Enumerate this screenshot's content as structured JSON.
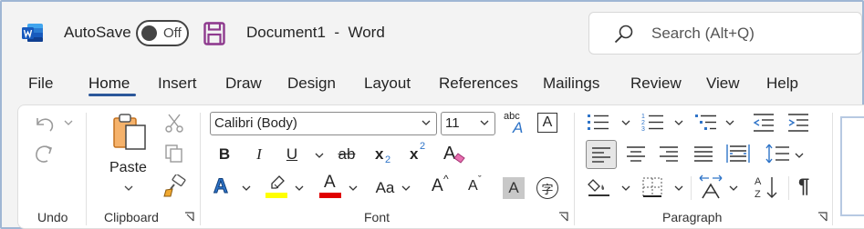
{
  "titlebar": {
    "autosave_label": "AutoSave",
    "autosave_state": "Off",
    "document_title": "Document1  -  Word",
    "search_placeholder": "Search (Alt+Q)"
  },
  "tabs": [
    {
      "label": "File",
      "active": false
    },
    {
      "label": "Home",
      "active": true
    },
    {
      "label": "Insert",
      "active": false
    },
    {
      "label": "Draw",
      "active": false
    },
    {
      "label": "Design",
      "active": false
    },
    {
      "label": "Layout",
      "active": false
    },
    {
      "label": "References",
      "active": false
    },
    {
      "label": "Mailings",
      "active": false
    },
    {
      "label": "Review",
      "active": false
    },
    {
      "label": "View",
      "active": false
    },
    {
      "label": "Help",
      "active": false
    }
  ],
  "groups": {
    "undo": "Undo",
    "clipboard": "Clipboard",
    "font": "Font",
    "paragraph": "Paragraph"
  },
  "clipboard": {
    "paste_label": "Paste"
  },
  "font": {
    "font_name": "Calibri (Body)",
    "font_size": "11",
    "bold": "B",
    "italic": "I",
    "underline": "U",
    "strike": "ab",
    "subscript_base": "x",
    "subscript_mark": "2",
    "superscript_base": "x",
    "superscript_mark": "2",
    "change_case": "Aa",
    "grow": "A",
    "shrink": "A",
    "shading_char": "A",
    "phonetic_top": "abc",
    "phonetic_base": "A",
    "text_effects": "A",
    "font_color": "A",
    "enclose_char": "字",
    "char_border": "A"
  },
  "colors": {
    "word_blue": "#2b579a",
    "highlight_yellow": "#ffff00",
    "font_red": "#e00000",
    "save_purple": "#8e3a8e",
    "text_effects_blue": "#2f74c8"
  },
  "icons": [
    "word-logo-icon",
    "save-icon",
    "search-icon",
    "undo-icon",
    "redo-icon",
    "cut-icon",
    "copy-icon",
    "format-painter-icon",
    "eraser-icon",
    "bullets-icon",
    "numbering-icon",
    "multilevel-icon",
    "decrease-indent-icon",
    "increase-indent-icon",
    "align-left-icon",
    "center-icon",
    "align-right-icon",
    "justify-icon",
    "distributed-icon",
    "line-spacing-icon",
    "shading-icon",
    "borders-icon",
    "text-direction-icon",
    "sort-icon",
    "pilcrow-icon"
  ]
}
